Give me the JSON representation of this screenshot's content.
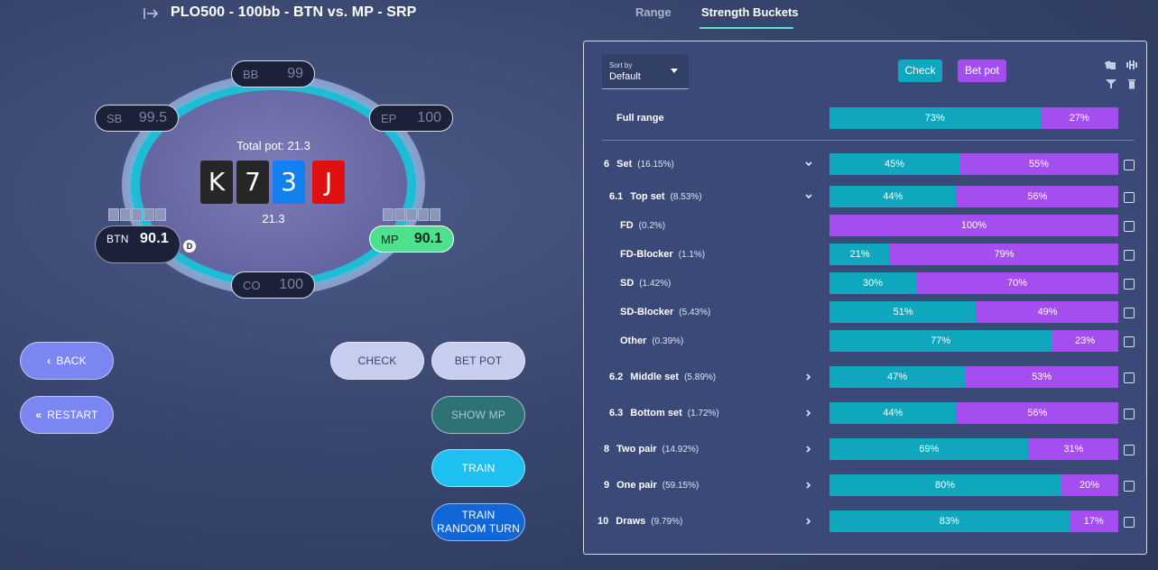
{
  "header": {
    "title": "PLO500 - 100bb - BTN vs. MP - SRP",
    "tabs": [
      {
        "label": "Range",
        "active": false
      },
      {
        "label": "Strength Buckets",
        "active": true
      }
    ]
  },
  "table": {
    "total_pot_label": "Total pot: 21.3",
    "pot_amount": "21.3",
    "board": [
      {
        "rank": "K",
        "suit": "spade",
        "color": "#262626"
      },
      {
        "rank": "7",
        "suit": "spade",
        "color": "#262626"
      },
      {
        "rank": "3",
        "suit": "diamond",
        "color": "#1480f0"
      },
      {
        "rank": "J",
        "suit": "heart",
        "color": "#e01010"
      }
    ],
    "seats": {
      "bb": {
        "pos": "BB",
        "stack": "99"
      },
      "sb": {
        "pos": "SB",
        "stack": "99.5"
      },
      "ep": {
        "pos": "EP",
        "stack": "100"
      },
      "btn": {
        "pos": "BTN",
        "stack": "90.1"
      },
      "mp": {
        "pos": "MP",
        "stack": "90.1"
      },
      "co": {
        "pos": "CO",
        "stack": "100"
      }
    },
    "dealer_label": "D"
  },
  "buttons": {
    "back": "BACK",
    "restart": "RESTART",
    "check": "CHECK",
    "bet_pot": "BET POT",
    "show_mp": "SHOW MP",
    "train": "TRAIN",
    "train_random_line1": "TRAIN",
    "train_random_line2": "RANDOM TURN"
  },
  "panel": {
    "sort_label": "Sort by",
    "sort_value": "Default",
    "legend_check": "Check",
    "legend_bet": "Bet pot",
    "colors": {
      "check": "#0ea7bd",
      "bet": "#a44ef0"
    },
    "full_range": {
      "label": "Full range",
      "check": 73,
      "bet": 27,
      "check_text": "73%",
      "bet_text": "27%"
    },
    "rows": [
      {
        "num": "6",
        "label": "Set",
        "pct": "(16.15%)",
        "arrow": "down",
        "check": 45,
        "bet": 55,
        "check_text": "45%",
        "bet_text": "55%"
      },
      {
        "num": "6.1",
        "label": "Top set",
        "pct": "(8.53%)",
        "arrow": "down",
        "check": 44,
        "bet": 56,
        "check_text": "44%",
        "bet_text": "56%"
      },
      {
        "num": "",
        "label": "FD",
        "pct": "(0.2%)",
        "arrow": "",
        "check": 0,
        "bet": 100,
        "check_text": "",
        "bet_text": "100%"
      },
      {
        "num": "",
        "label": "FD-Blocker",
        "pct": "(1.1%)",
        "arrow": "",
        "check": 21,
        "bet": 79,
        "check_text": "21%",
        "bet_text": "79%"
      },
      {
        "num": "",
        "label": "SD",
        "pct": "(1.42%)",
        "arrow": "",
        "check": 30,
        "bet": 70,
        "check_text": "30%",
        "bet_text": "70%"
      },
      {
        "num": "",
        "label": "SD-Blocker",
        "pct": "(5.43%)",
        "arrow": "",
        "check": 51,
        "bet": 49,
        "check_text": "51%",
        "bet_text": "49%"
      },
      {
        "num": "",
        "label": "Other",
        "pct": "(0.39%)",
        "arrow": "",
        "check": 77,
        "bet": 23,
        "check_text": "77%",
        "bet_text": "23%"
      },
      {
        "num": "6.2",
        "label": "Middle set",
        "pct": "(5.89%)",
        "arrow": "right",
        "check": 47,
        "bet": 53,
        "check_text": "47%",
        "bet_text": "53%"
      },
      {
        "num": "6.3",
        "label": "Bottom set",
        "pct": "(1.72%)",
        "arrow": "right",
        "check": 44,
        "bet": 56,
        "check_text": "44%",
        "bet_text": "56%"
      },
      {
        "num": "8",
        "label": "Two pair",
        "pct": "(14.92%)",
        "arrow": "right",
        "check": 69,
        "bet": 31,
        "check_text": "69%",
        "bet_text": "31%"
      },
      {
        "num": "9",
        "label": "One pair",
        "pct": "(59.15%)",
        "arrow": "right",
        "check": 80,
        "bet": 20,
        "check_text": "80%",
        "bet_text": "20%"
      },
      {
        "num": "10",
        "label": "Draws",
        "pct": "(9.79%)",
        "arrow": "right",
        "check": 83,
        "bet": 17,
        "check_text": "83%",
        "bet_text": "17%"
      }
    ]
  }
}
